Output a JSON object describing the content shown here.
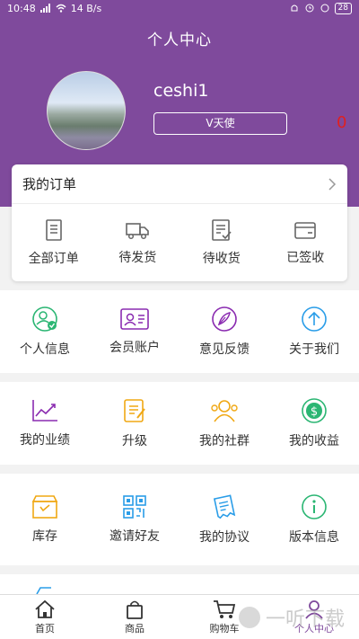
{
  "status": {
    "time": "10:48",
    "speed": "14 B/s",
    "battery": "28"
  },
  "header": {
    "title": "个人中心",
    "username": "ceshi1",
    "level": "V天使",
    "counter": "0"
  },
  "orders": {
    "title": "我的订单",
    "items": [
      {
        "label": "全部订单",
        "icon": "document-icon"
      },
      {
        "label": "待发货",
        "icon": "truck-icon"
      },
      {
        "label": "待收货",
        "icon": "checklist-icon"
      },
      {
        "label": "已签收",
        "icon": "wallet-icon"
      }
    ]
  },
  "menu": {
    "row1": [
      {
        "label": "个人信息",
        "icon": "user-check-icon",
        "color": "#2bb673"
      },
      {
        "label": "会员账户",
        "icon": "id-card-icon",
        "color": "#8a2bb0"
      },
      {
        "label": "意见反馈",
        "icon": "feather-icon",
        "color": "#8a2bb0"
      },
      {
        "label": "关于我们",
        "icon": "up-arrow-icon",
        "color": "#2a9de8"
      }
    ],
    "row2": [
      {
        "label": "我的业绩",
        "icon": "chart-icon",
        "color": "#8a2bb0"
      },
      {
        "label": "升级",
        "icon": "edit-icon",
        "color": "#f0a814"
      },
      {
        "label": "我的社群",
        "icon": "group-icon",
        "color": "#f0a814"
      },
      {
        "label": "我的收益",
        "icon": "dollar-icon",
        "color": "#2bb673"
      }
    ],
    "row3": [
      {
        "label": "库存",
        "icon": "box-icon",
        "color": "#f0a814"
      },
      {
        "label": "邀请好友",
        "icon": "qrcode-icon",
        "color": "#2a9de8"
      },
      {
        "label": "我的协议",
        "icon": "contract-icon",
        "color": "#2a9de8"
      },
      {
        "label": "版本信息",
        "icon": "info-icon",
        "color": "#2bb673"
      }
    ]
  },
  "tabbar": [
    {
      "label": "首页",
      "icon": "home-icon"
    },
    {
      "label": "商品",
      "icon": "bag-icon"
    },
    {
      "label": "购物车",
      "icon": "cart-icon"
    },
    {
      "label": "个人中心",
      "icon": "person-icon"
    }
  ],
  "watermark": "一听下载"
}
